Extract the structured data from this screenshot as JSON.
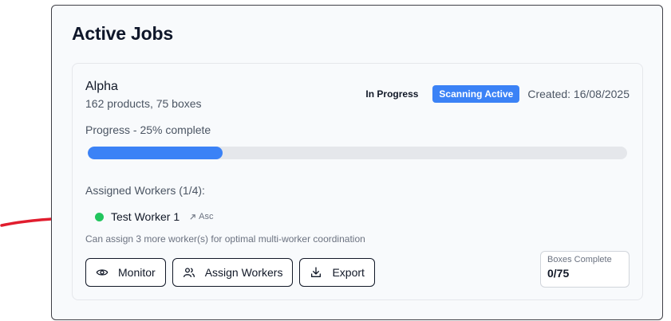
{
  "section": {
    "title": "Active Jobs"
  },
  "job": {
    "name": "Alpha",
    "summary": "162 products, 75 boxes",
    "status": "In Progress",
    "badge": "Scanning Active",
    "created": "Created: 16/08/2025",
    "progress_label": "Progress - 25% complete",
    "progress_fraction": 0.25,
    "workers_label": "Assigned Workers (1/4):",
    "workers": [
      {
        "name": "Test Worker 1",
        "tag": "Asc",
        "status_color": "#22c55e"
      }
    ],
    "assign_hint": "Can assign 3 more worker(s) for optimal multi-worker coordination",
    "actions": {
      "monitor_label": "Monitor",
      "assign_label": "Assign Workers",
      "export_label": "Export"
    },
    "boxes": {
      "label": "Boxes Complete",
      "value": "0/75"
    }
  },
  "icons": {
    "monitor": "eye-icon",
    "assign": "users-icon",
    "export": "download-icon",
    "worker_tag": "arrow-up-right-icon"
  },
  "colors": {
    "accent": "#3b82f6",
    "worker_online": "#22c55e",
    "annotation": "#e11d2e"
  }
}
